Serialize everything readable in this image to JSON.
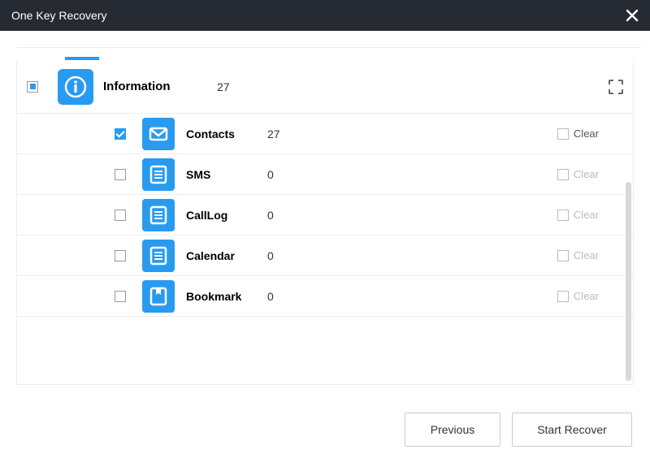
{
  "window": {
    "title": "One Key Recovery"
  },
  "category": {
    "name": "Information",
    "count": "27",
    "checkbox_state": "partial"
  },
  "items": [
    {
      "name": "Contacts",
      "count": "27",
      "checked": true,
      "clear_enabled": true,
      "clear_label": "Clear",
      "icon": "mail"
    },
    {
      "name": "SMS",
      "count": "0",
      "checked": false,
      "clear_enabled": false,
      "clear_label": "Clear",
      "icon": "doc"
    },
    {
      "name": "CallLog",
      "count": "0",
      "checked": false,
      "clear_enabled": false,
      "clear_label": "Clear",
      "icon": "doc"
    },
    {
      "name": "Calendar",
      "count": "0",
      "checked": false,
      "clear_enabled": false,
      "clear_label": "Clear",
      "icon": "doc"
    },
    {
      "name": "Bookmark",
      "count": "0",
      "checked": false,
      "clear_enabled": false,
      "clear_label": "Clear",
      "icon": "book"
    }
  ],
  "buttons": {
    "previous": "Previous",
    "start_recover": "Start Recover"
  }
}
